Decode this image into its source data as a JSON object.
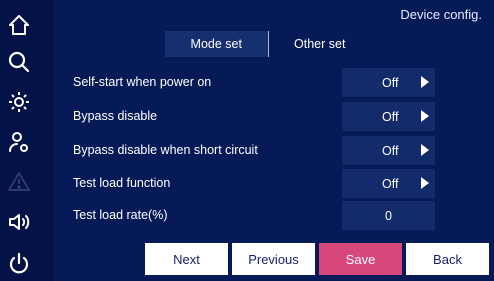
{
  "header": {
    "title": "Device config."
  },
  "tabs": [
    {
      "label": "Mode set",
      "active": true
    },
    {
      "label": "Other set",
      "active": false
    }
  ],
  "settings": [
    {
      "label": "Self-start when power on",
      "value": "Off",
      "has_arrow": true
    },
    {
      "label": "Bypass disable",
      "value": "Off",
      "has_arrow": true
    },
    {
      "label": "Bypass disable when short circuit",
      "value": "Off",
      "has_arrow": true
    },
    {
      "label": "Test load function",
      "value": "Off",
      "has_arrow": true
    },
    {
      "label": "Test load rate(%)",
      "value": "0",
      "has_arrow": false
    }
  ],
  "buttons": {
    "next": "Next",
    "previous": "Previous",
    "save": "Save",
    "back": "Back"
  },
  "sidebar": {
    "icons": [
      "home-icon",
      "search-icon",
      "settings-icon",
      "user-settings-icon",
      "warning-icon",
      "speaker-icon",
      "power-icon"
    ]
  },
  "colors": {
    "background": "#041347",
    "panel": "#061a58",
    "value_box": "#132b6a",
    "save_button": "#d8477b",
    "button_light": "#ffffff",
    "disabled_icon": "#2b3a70"
  }
}
